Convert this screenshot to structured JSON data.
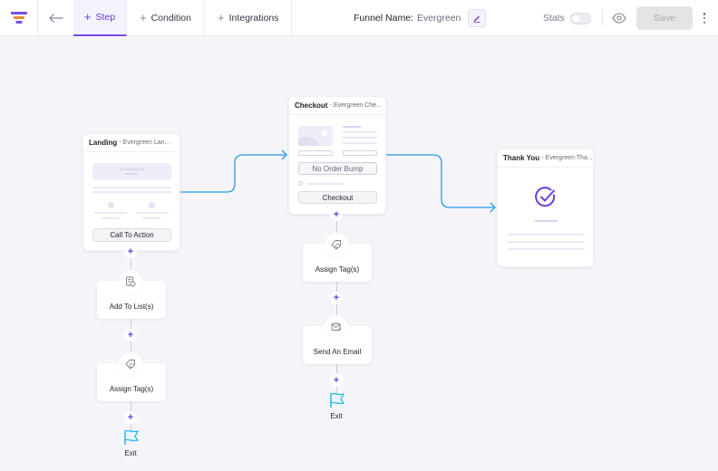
{
  "header": {
    "logo_icon": "funnel-logo-icon",
    "back_icon": "arrow-left-icon",
    "tabs": [
      {
        "label": "Step",
        "icon": "plus-icon",
        "active": true
      },
      {
        "label": "Condition",
        "icon": "plus-icon",
        "active": false
      },
      {
        "label": "Integrations",
        "icon": "plus-icon",
        "active": false
      }
    ],
    "funnel_name_label": "Funnel Name:",
    "funnel_name_value": "Evergreen",
    "edit_icon": "pencil-icon",
    "stats_label": "Stats",
    "stats_enabled": false,
    "preview_icon": "eye-icon",
    "save_label": "Save",
    "save_disabled": true,
    "more_icon": "kebab-menu-icon"
  },
  "colors": {
    "accent": "#6b3fd6",
    "connector": "#2a9be6",
    "exit_flag": "#27b8e8",
    "logo_top": "#7a4de0",
    "logo_mid": "#f08a2c"
  },
  "steps": {
    "landing": {
      "type": "Landing",
      "name": "- Evergreen Lan...",
      "button": "Call To Action"
    },
    "checkout": {
      "type": "Checkout",
      "name": "- Evergreen Che...",
      "order_bump": "No Order Bump",
      "button": "Checkout"
    },
    "thankyou": {
      "type": "Thank You",
      "name": "- Evergreen Tha..."
    }
  },
  "landing_actions": [
    {
      "label": "Add To List(s)",
      "icon": "list-add-icon"
    },
    {
      "label": "Assign Tag(s)",
      "icon": "tag-icon"
    }
  ],
  "checkout_actions": [
    {
      "label": "Assign Tag(s)",
      "icon": "tag-icon"
    },
    {
      "label": "Send An Email",
      "icon": "email-icon"
    }
  ],
  "exit_label": "Exit",
  "add_symbol": "+"
}
